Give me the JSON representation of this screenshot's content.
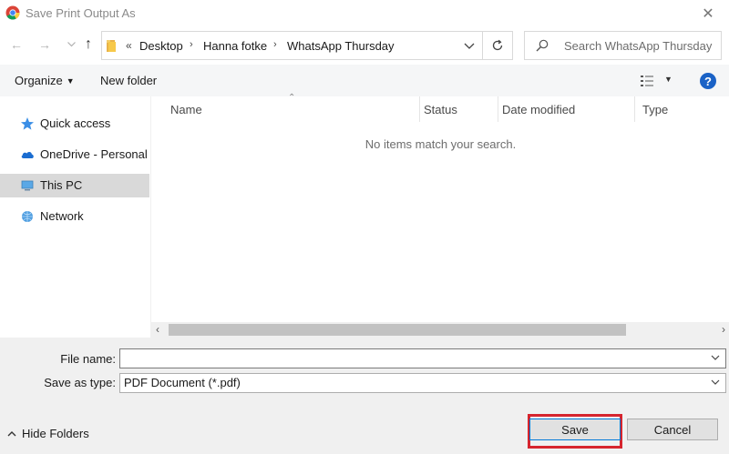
{
  "window": {
    "title": "Save Print Output As",
    "close_glyph": "✕"
  },
  "nav": {
    "back_glyph": "←",
    "forward_glyph": "→",
    "up_glyph": "↑",
    "overflow_glyph": "«",
    "breadcrumb": [
      "Desktop",
      "Hanna fotke",
      "WhatsApp Thursday"
    ],
    "search_placeholder": "Search WhatsApp Thursday"
  },
  "toolbar": {
    "organize_label": "Organize",
    "new_folder_label": "New folder",
    "help_label": "?"
  },
  "sidebar": {
    "items": [
      {
        "label": "Quick access",
        "icon": "star-icon"
      },
      {
        "label": "OneDrive - Personal",
        "icon": "cloud-icon"
      },
      {
        "label": "This PC",
        "icon": "computer-icon",
        "selected": true
      },
      {
        "label": "Network",
        "icon": "network-icon"
      }
    ]
  },
  "columns": [
    "Name",
    "Status",
    "Date modified",
    "Type"
  ],
  "content": {
    "empty_message": "No items match your search."
  },
  "form": {
    "file_name_label": "File name:",
    "file_name_value": "",
    "save_type_label": "Save as type:",
    "save_type_value": "PDF Document (*.pdf)"
  },
  "footer": {
    "hide_folders_label": "Hide Folders",
    "save_label": "Save",
    "cancel_label": "Cancel"
  },
  "colors": {
    "accent": "#0078d7",
    "help": "#1a62c6",
    "highlight": "#d6252e",
    "selection": "#d9d9d9"
  }
}
